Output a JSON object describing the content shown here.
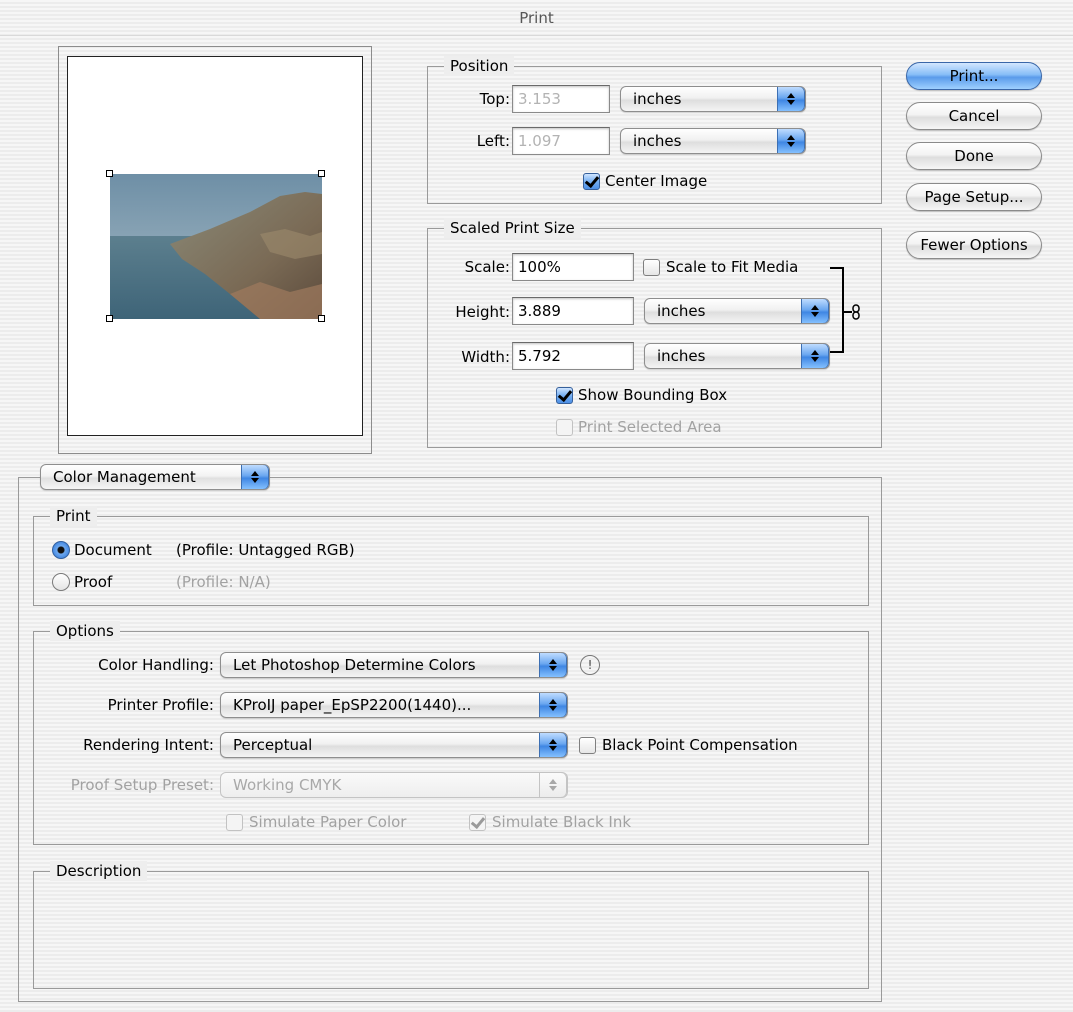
{
  "window": {
    "title": "Print"
  },
  "buttons": {
    "print": "Print...",
    "cancel": "Cancel",
    "done": "Done",
    "page_setup": "Page Setup...",
    "fewer_options": "Fewer Options"
  },
  "position": {
    "legend": "Position",
    "top_label": "Top:",
    "top_value": "3.153",
    "top_unit": "inches",
    "left_label": "Left:",
    "left_value": "1.097",
    "left_unit": "inches",
    "center_image_label": "Center Image",
    "center_image_checked": true
  },
  "scaled": {
    "legend": "Scaled Print Size",
    "scale_label": "Scale:",
    "scale_value": "100%",
    "scale_to_fit_label": "Scale to Fit Media",
    "scale_to_fit_checked": false,
    "height_label": "Height:",
    "height_value": "3.889",
    "height_unit": "inches",
    "width_label": "Width:",
    "width_value": "5.792",
    "width_unit": "inches",
    "show_bounding_box_label": "Show Bounding Box",
    "show_bounding_box_checked": true,
    "print_selected_area_label": "Print Selected Area",
    "print_selected_area_checked": false
  },
  "section_popup": {
    "value": "Color Management"
  },
  "print_group": {
    "legend": "Print",
    "document_label": "Document",
    "document_profile": "(Profile: Untagged RGB)",
    "proof_label": "Proof",
    "proof_profile": "(Profile: N/A)",
    "selected": "Document"
  },
  "options": {
    "legend": "Options",
    "color_handling_label": "Color Handling:",
    "color_handling_value": "Let Photoshop Determine Colors",
    "printer_profile_label": "Printer Profile:",
    "printer_profile_value": "KProIJ paper_EpSP2200(1440)...",
    "rendering_intent_label": "Rendering Intent:",
    "rendering_intent_value": "Perceptual",
    "black_point_label": "Black Point Compensation",
    "black_point_checked": false,
    "proof_setup_label": "Proof Setup Preset:",
    "proof_setup_value": "Working CMYK",
    "simulate_paper_label": "Simulate Paper Color",
    "simulate_paper_checked": false,
    "simulate_ink_label": "Simulate Black Ink",
    "simulate_ink_checked": true,
    "info_icon": "!"
  },
  "description": {
    "legend": "Description",
    "text": ""
  },
  "icons": {
    "popup_arrows": "updown-arrows-icon",
    "link": "chain-link-icon",
    "warning": "exclamation-icon"
  },
  "colors": {
    "accent_blue": "#5a9bea",
    "background": "#ececec",
    "disabled_text": "#a2a2a2"
  }
}
